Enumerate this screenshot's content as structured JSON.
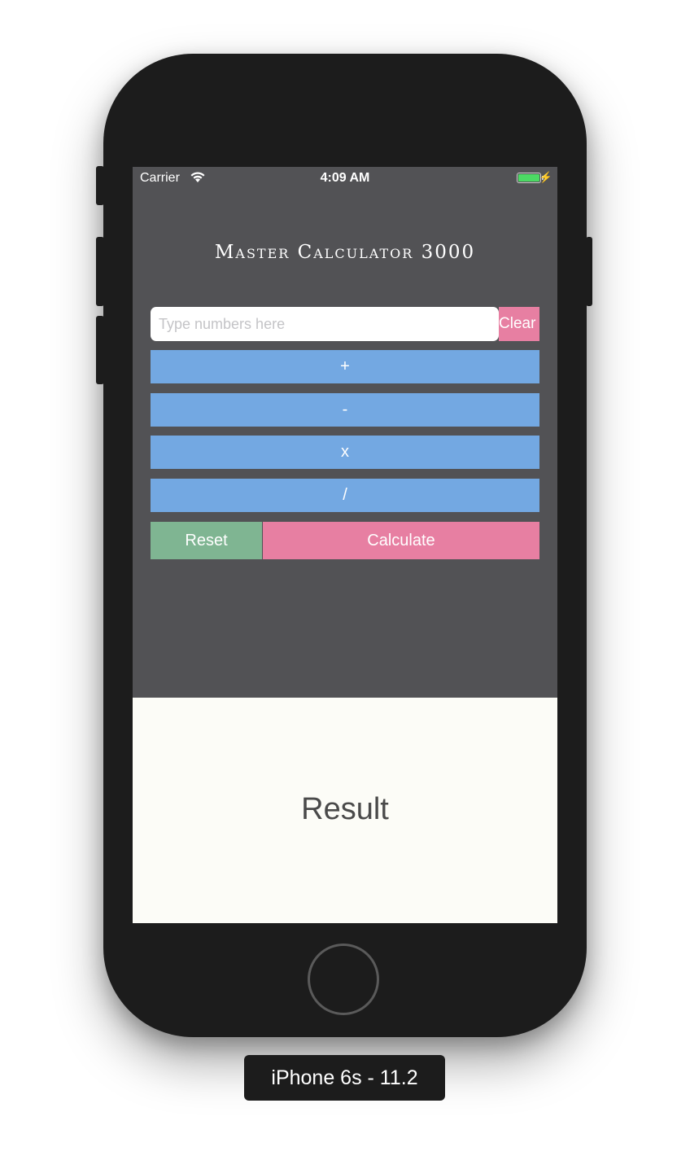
{
  "status_bar": {
    "carrier": "Carrier",
    "time": "4:09 AM",
    "battery_color": "#4cd964"
  },
  "app": {
    "title": "Master Calculator 3000",
    "input": {
      "value": "",
      "placeholder": "Type numbers here"
    },
    "clear_label": "Clear",
    "operations": [
      "+",
      "-",
      "x",
      "/"
    ],
    "reset_label": "Reset",
    "calculate_label": "Calculate",
    "result_label": "Result"
  },
  "simulator": {
    "device_label": "iPhone 6s - 11.2"
  },
  "colors": {
    "screen_bg": "#525255",
    "operation_blue": "#73a8e2",
    "accent_pink": "#e77fa2",
    "reset_green": "#7fb592",
    "result_bg": "#fcfcf7"
  }
}
